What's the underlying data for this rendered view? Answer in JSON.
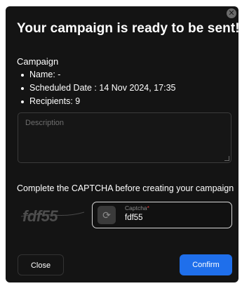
{
  "dialog": {
    "title": "Your campaign is ready to be sent!",
    "close_icon": "close-icon"
  },
  "campaign": {
    "heading": "Campaign",
    "details": [
      "Name: -",
      "Scheduled Date : 14 Nov 2024, 17:35",
      "Recipients: 9"
    ]
  },
  "description": {
    "placeholder": "Description"
  },
  "captcha": {
    "prompt": "Complete the CAPTCHA before creating your campaign",
    "image_text": "fdf55",
    "refresh_icon": "refresh-icon",
    "label": "Captcha",
    "required_mark": "*",
    "value": "fdf55"
  },
  "actions": {
    "close_label": "Close",
    "confirm_label": "Confirm"
  },
  "colors": {
    "modal_bg": "#141414",
    "accent": "#1f6feb",
    "required": "#e23b3b"
  }
}
